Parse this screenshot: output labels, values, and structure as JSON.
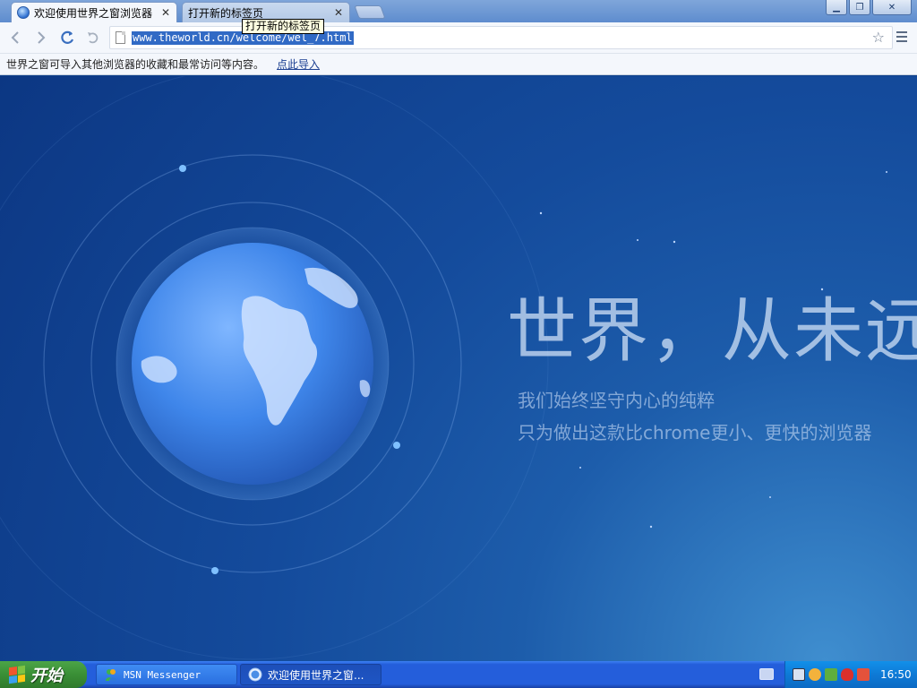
{
  "browser": {
    "tabs": [
      {
        "label": "欢迎使用世界之窗浏览器",
        "active": true
      },
      {
        "label": "打开新的标签页",
        "active": false
      }
    ],
    "tooltip": "打开新的标签页",
    "address": {
      "url": "www.theworld.cn/welcome/wel_7.html",
      "selected": true
    },
    "infobar": {
      "text": "世界之窗可导入其他浏览器的收藏和最常访问等内容。",
      "link": "点此导入"
    },
    "icons": {
      "back": "chevron-left-icon",
      "forward": "chevron-right-icon",
      "reload": "reload-icon",
      "undo": "undo-close-tab-icon",
      "bookmark": "star-icon",
      "menu": "hamburger-menu-icon"
    }
  },
  "page": {
    "headline": "世界，从未远去",
    "line1": "我们始终坚守内心的纯粹",
    "line2": "只为做出这款比chrome更小、更快的浏览器"
  },
  "taskbar": {
    "start_label": "开始",
    "tasks": [
      {
        "label": "MSN Messenger",
        "icon": "msn-icon"
      },
      {
        "label": "欢迎使用世界之窗...",
        "icon": "theworld-browser-icon"
      }
    ],
    "clock": "16:50"
  },
  "colors": {
    "accent": "#316ac5",
    "taskbar_blue": "#245edb",
    "start_green": "#3a8f36",
    "page_bg": "#144b9c"
  }
}
